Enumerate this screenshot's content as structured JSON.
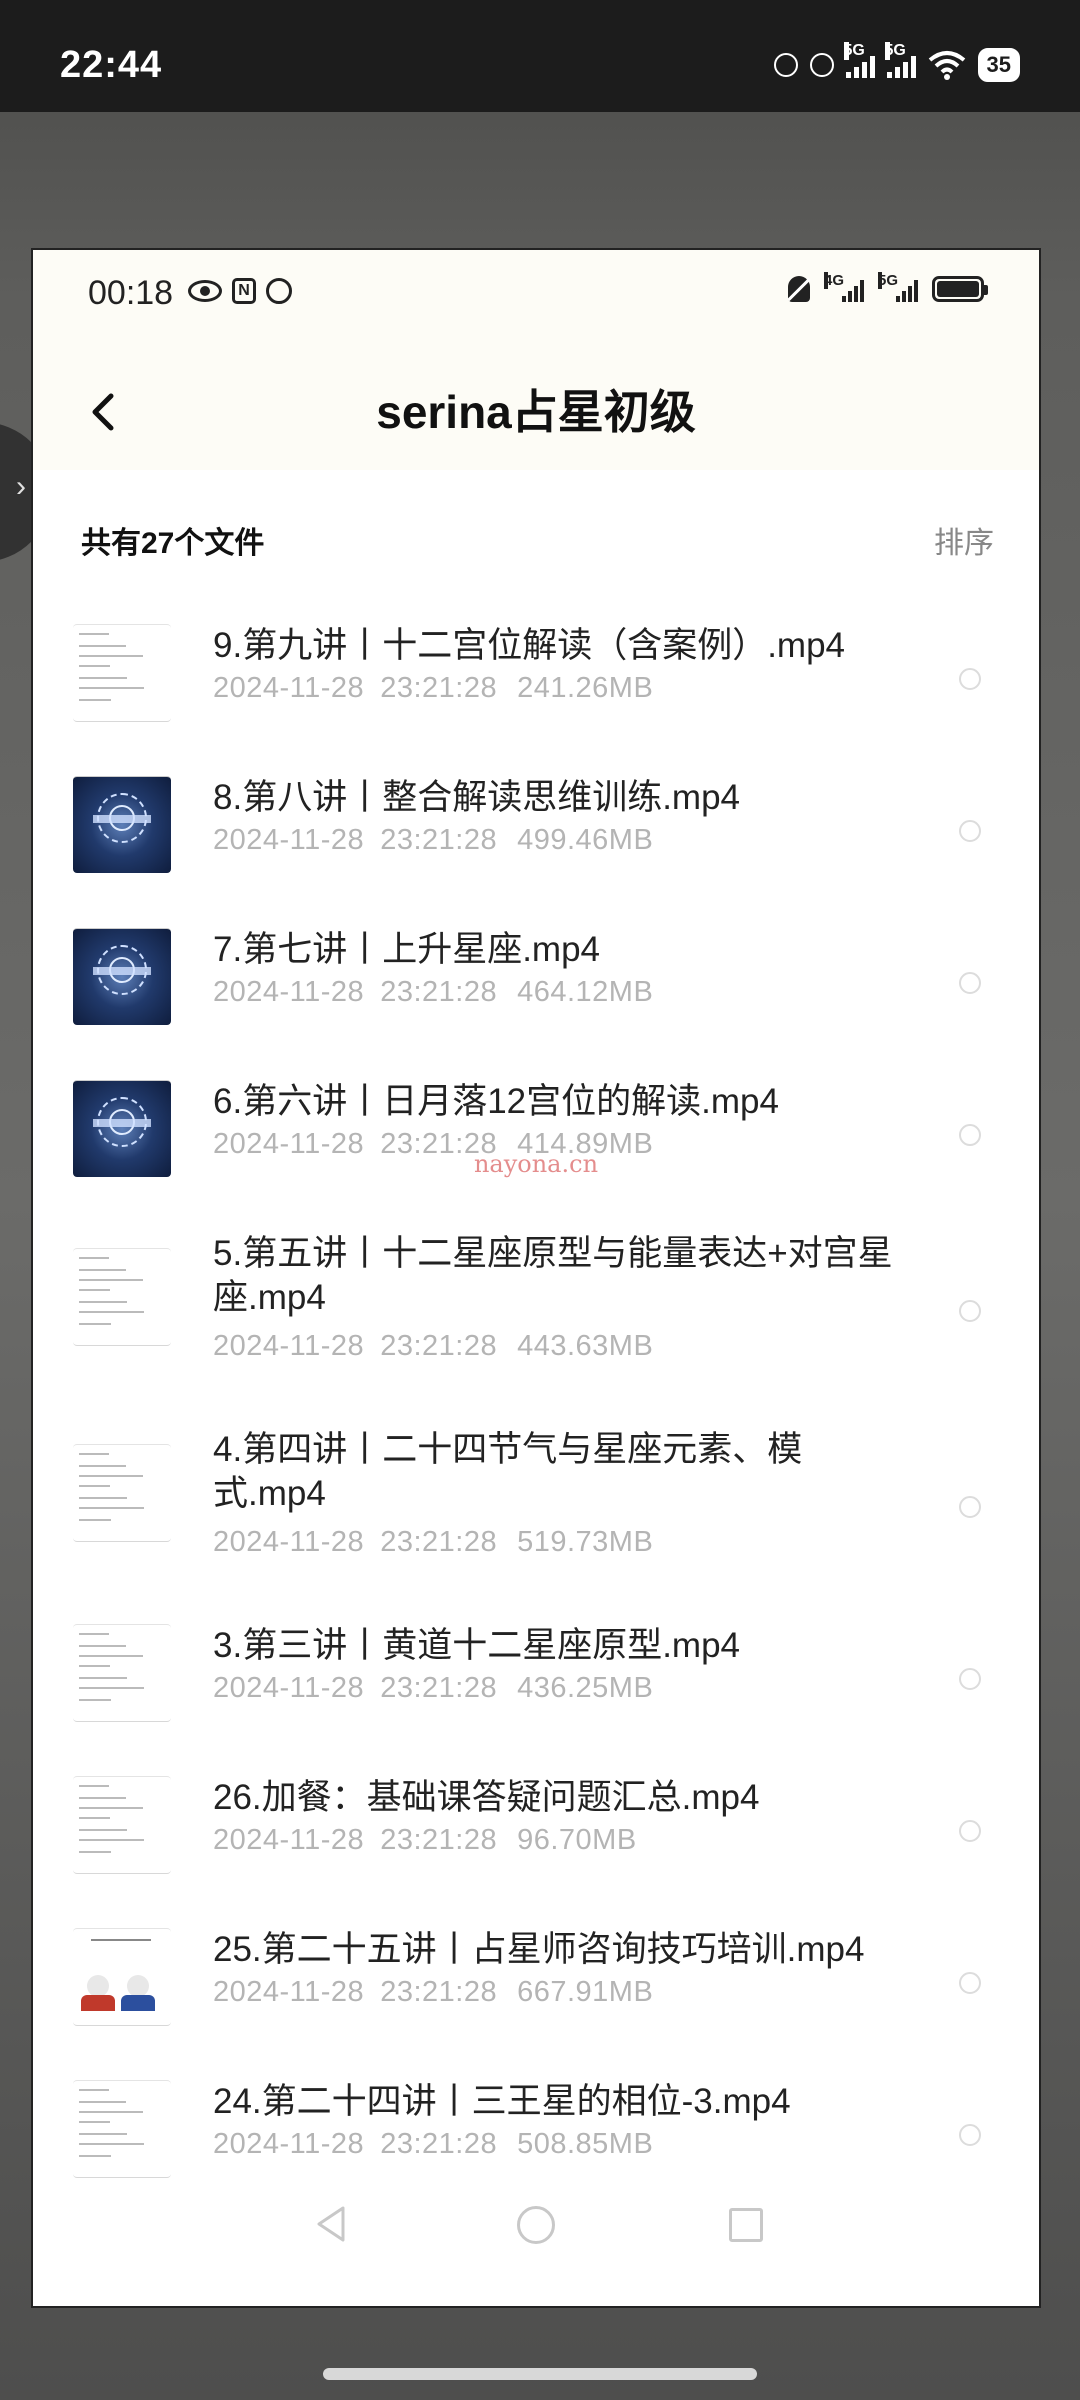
{
  "outer_status": {
    "time": "22:44",
    "net1": "5G",
    "net2": "5G",
    "battery": "35",
    "icons": [
      "timer-icon",
      "alarm-off-icon",
      "signal-icon",
      "signal-icon",
      "wifi-icon",
      "battery-icon"
    ]
  },
  "inner_status": {
    "time": "00:18",
    "net1": "4G",
    "net2": "5G",
    "icons": [
      "eye-icon",
      "nfc-icon",
      "alarm-icon",
      "bell-mute-icon",
      "signal-icon",
      "signal-icon",
      "battery-icon"
    ]
  },
  "header": {
    "title": "serina占星初级",
    "back_icon": "chevron-left-icon"
  },
  "toolbar": {
    "count_label": "共有27个文件",
    "sort_label": "排序"
  },
  "files": [
    {
      "name": "9.第九讲丨十二宫位解读（含案例）.mp4",
      "date": "2024-11-28",
      "time": "23:21:28",
      "size": "241.26MB",
      "thumb": "document"
    },
    {
      "name": "8.第八讲丨整合解读思维训练.mp4",
      "date": "2024-11-28",
      "time": "23:21:28",
      "size": "499.46MB",
      "thumb": "astrology-chart"
    },
    {
      "name": "7.第七讲丨上升星座.mp4",
      "date": "2024-11-28",
      "time": "23:21:28",
      "size": "464.12MB",
      "thumb": "astrology-chart"
    },
    {
      "name": "6.第六讲丨日月落12宫位的解读.mp4",
      "date": "2024-11-28",
      "time": "23:21:28",
      "size": "414.89MB",
      "thumb": "astrology-chart"
    },
    {
      "name": "5.第五讲丨十二星座原型与能量表达+对宫星座.mp4",
      "date": "2024-11-28",
      "time": "23:21:28",
      "size": "443.63MB",
      "thumb": "document"
    },
    {
      "name": "4.第四讲丨二十四节气与星座元素、模式.mp4",
      "date": "2024-11-28",
      "time": "23:21:28",
      "size": "519.73MB",
      "thumb": "document"
    },
    {
      "name": "3.第三讲丨黄道十二星座原型.mp4",
      "date": "2024-11-28",
      "time": "23:21:28",
      "size": "436.25MB",
      "thumb": "document"
    },
    {
      "name": "26.加餐：基础课答疑问题汇总.mp4",
      "date": "2024-11-28",
      "time": "23:21:28",
      "size": "96.70MB",
      "thumb": "document"
    },
    {
      "name": "25.第二十五讲丨占星师咨询技巧培训.mp4",
      "date": "2024-11-28",
      "time": "23:21:28",
      "size": "667.91MB",
      "thumb": "people"
    },
    {
      "name": "24.第二十四讲丨三王星的相位-3.mp4",
      "date": "2024-11-28",
      "time": "23:21:28",
      "size": "508.85MB",
      "thumb": "document"
    }
  ],
  "watermark": "nayona.cn",
  "nav": {
    "back_icon": "nav-back-icon",
    "home_icon": "nav-home-icon",
    "recent_icon": "nav-recent-icon"
  }
}
